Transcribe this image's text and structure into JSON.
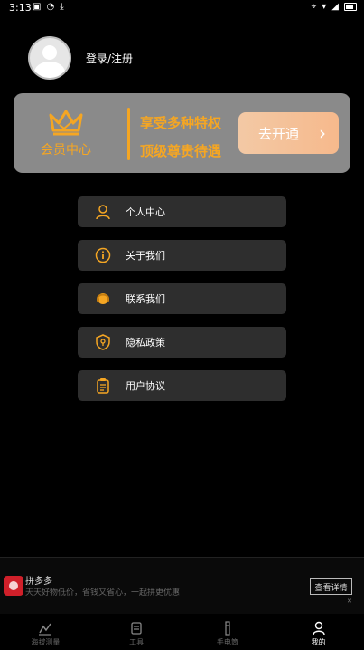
{
  "status_bar": {
    "time": "3:13"
  },
  "profile": {
    "login_label": "登录/注册"
  },
  "vip": {
    "title": "会员中心",
    "line1": "享受多种特权",
    "line2": "顶级尊贵待遇",
    "button_label": "去开通",
    "accent_color": "#f5a623"
  },
  "menu": {
    "items": [
      {
        "label": "个人中心",
        "icon": "user-icon"
      },
      {
        "label": "关于我们",
        "icon": "info-icon"
      },
      {
        "label": "联系我们",
        "icon": "headset-icon"
      },
      {
        "label": "隐私政策",
        "icon": "shield-icon"
      },
      {
        "label": "用户协议",
        "icon": "clipboard-icon"
      }
    ]
  },
  "ad": {
    "name": "拼多多",
    "text": "天天好物低价，省钱又省心，一起拼更优惠",
    "button_label": "查看详情"
  },
  "tabs": [
    {
      "label": "海拔测量",
      "icon": "chart-icon",
      "active": false
    },
    {
      "label": "工具",
      "icon": "toolbox-icon",
      "active": false
    },
    {
      "label": "手电筒",
      "icon": "flashlight-icon",
      "active": false
    },
    {
      "label": "我的",
      "icon": "person-icon",
      "active": true
    }
  ]
}
